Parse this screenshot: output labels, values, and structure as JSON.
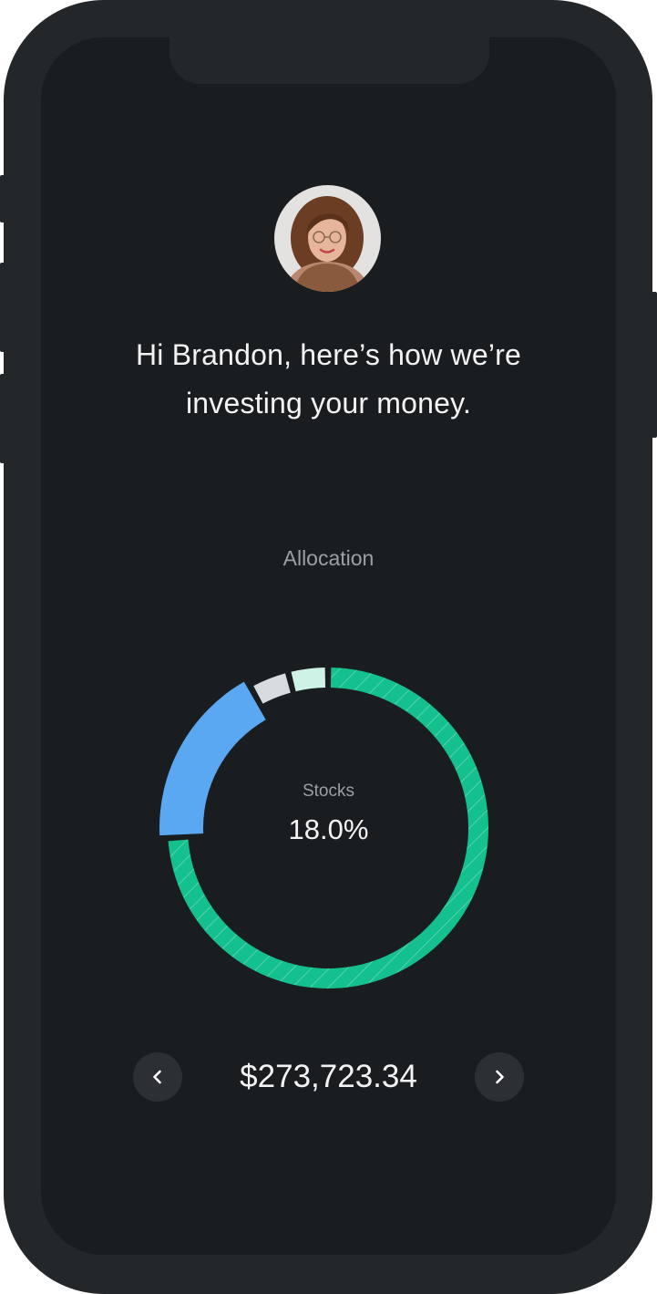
{
  "greeting": {
    "line1": "Hi Brandon, here’s how we’re",
    "line2": "investing your money."
  },
  "allocation": {
    "label": "Allocation",
    "selected_label": "Stocks",
    "selected_value": "18.0%"
  },
  "balance": {
    "amount": "$273,723.34"
  },
  "nav": {
    "prev_icon": "chevron-left-icon",
    "next_icon": "chevron-right-icon"
  },
  "colors": {
    "background": "#1a1d20",
    "bezel": "#23272a",
    "primary_segment": "#13c08e",
    "stocks_segment": "#5aa7f2",
    "gray_segment": "#d8dcde",
    "mint_segment": "#cff2e7"
  },
  "chart_data": {
    "type": "pie",
    "style": "donut",
    "categories": [
      "(unlabeled)",
      "Stocks",
      "(unlabeled)",
      "(unlabeled)"
    ],
    "values": [
      74,
      18,
      4,
      4
    ],
    "center_text": "Stocks 18.0%",
    "selected": "Stocks"
  }
}
